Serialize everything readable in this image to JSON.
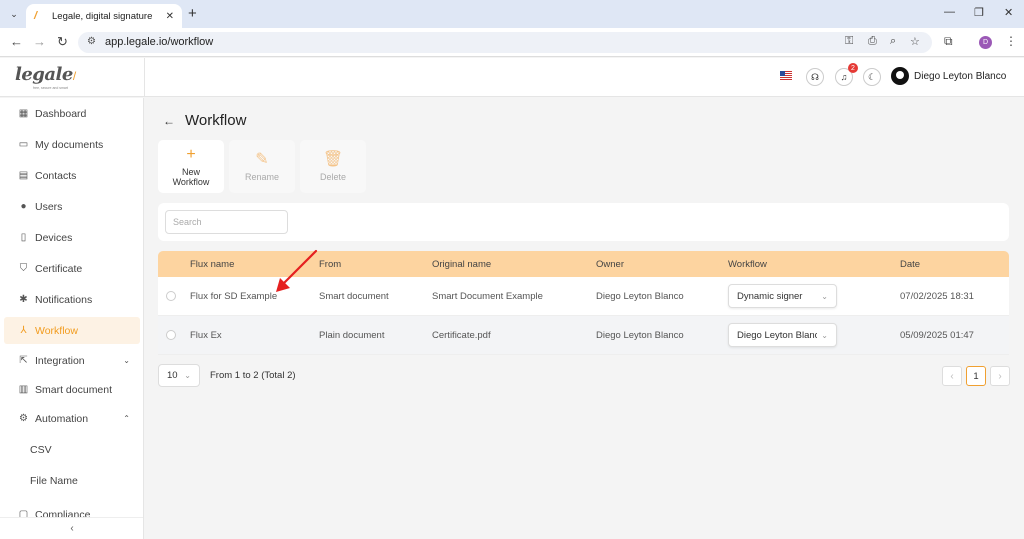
{
  "browser": {
    "tab_title": "Legale, digital signature",
    "url": "app.legale.io/workflow",
    "profile_initial": "D"
  },
  "header": {
    "logo_text": "legale",
    "logo_tagline": "free, secure and smart",
    "notification_count": "2",
    "user_name": "Diego Leyton Blanco"
  },
  "sidebar": {
    "items": [
      {
        "label": "Dashboard",
        "icon": "dashboard-icon"
      },
      {
        "label": "My documents",
        "icon": "folder-icon"
      },
      {
        "label": "Contacts",
        "icon": "contacts-icon"
      },
      {
        "label": "Users",
        "icon": "user-icon"
      },
      {
        "label": "Devices",
        "icon": "device-icon"
      },
      {
        "label": "Certificate",
        "icon": "shield-icon"
      },
      {
        "label": "Notifications",
        "icon": "bug-icon"
      },
      {
        "label": "Workflow",
        "icon": "workflow-icon",
        "active": true
      },
      {
        "label": "Integration",
        "icon": "external-link-icon"
      },
      {
        "label": "Smart document",
        "icon": "table-icon"
      },
      {
        "label": "Automation",
        "icon": "gear-icon"
      },
      {
        "label": "CSV"
      },
      {
        "label": "File Name"
      },
      {
        "label": "Compliance",
        "icon": "compliance-icon"
      }
    ]
  },
  "page": {
    "title": "Workflow"
  },
  "toolbar": {
    "new_label_1": "New",
    "new_label_2": "Workflow",
    "rename_label": "Rename",
    "delete_label": "Delete"
  },
  "search": {
    "placeholder": "Search",
    "value": ""
  },
  "table": {
    "columns": [
      "Flux name",
      "From",
      "Original name",
      "Owner",
      "Workflow",
      "Date"
    ],
    "rows": [
      {
        "flux_name": "Flux for SD Example",
        "from": "Smart document",
        "original_name": "Smart Document Example",
        "owner": "Diego Leyton Blanco",
        "workflow": "Dynamic signer",
        "date": "07/02/2025 18:31"
      },
      {
        "flux_name": "Flux Ex",
        "from": "Plain document",
        "original_name": "Certificate.pdf",
        "owner": "Diego Leyton Blanco",
        "workflow": "Diego Leyton Blanc...",
        "date": "05/09/2025 01:47"
      }
    ]
  },
  "pagination": {
    "page_size": "10",
    "info": "From 1 to 2 (Total 2)",
    "current_page": "1"
  },
  "colors": {
    "accent": "#f0a030",
    "table_header": "#fdd4a0",
    "active_bg": "#fdf2e4",
    "annotation_arrow": "#e52020"
  }
}
